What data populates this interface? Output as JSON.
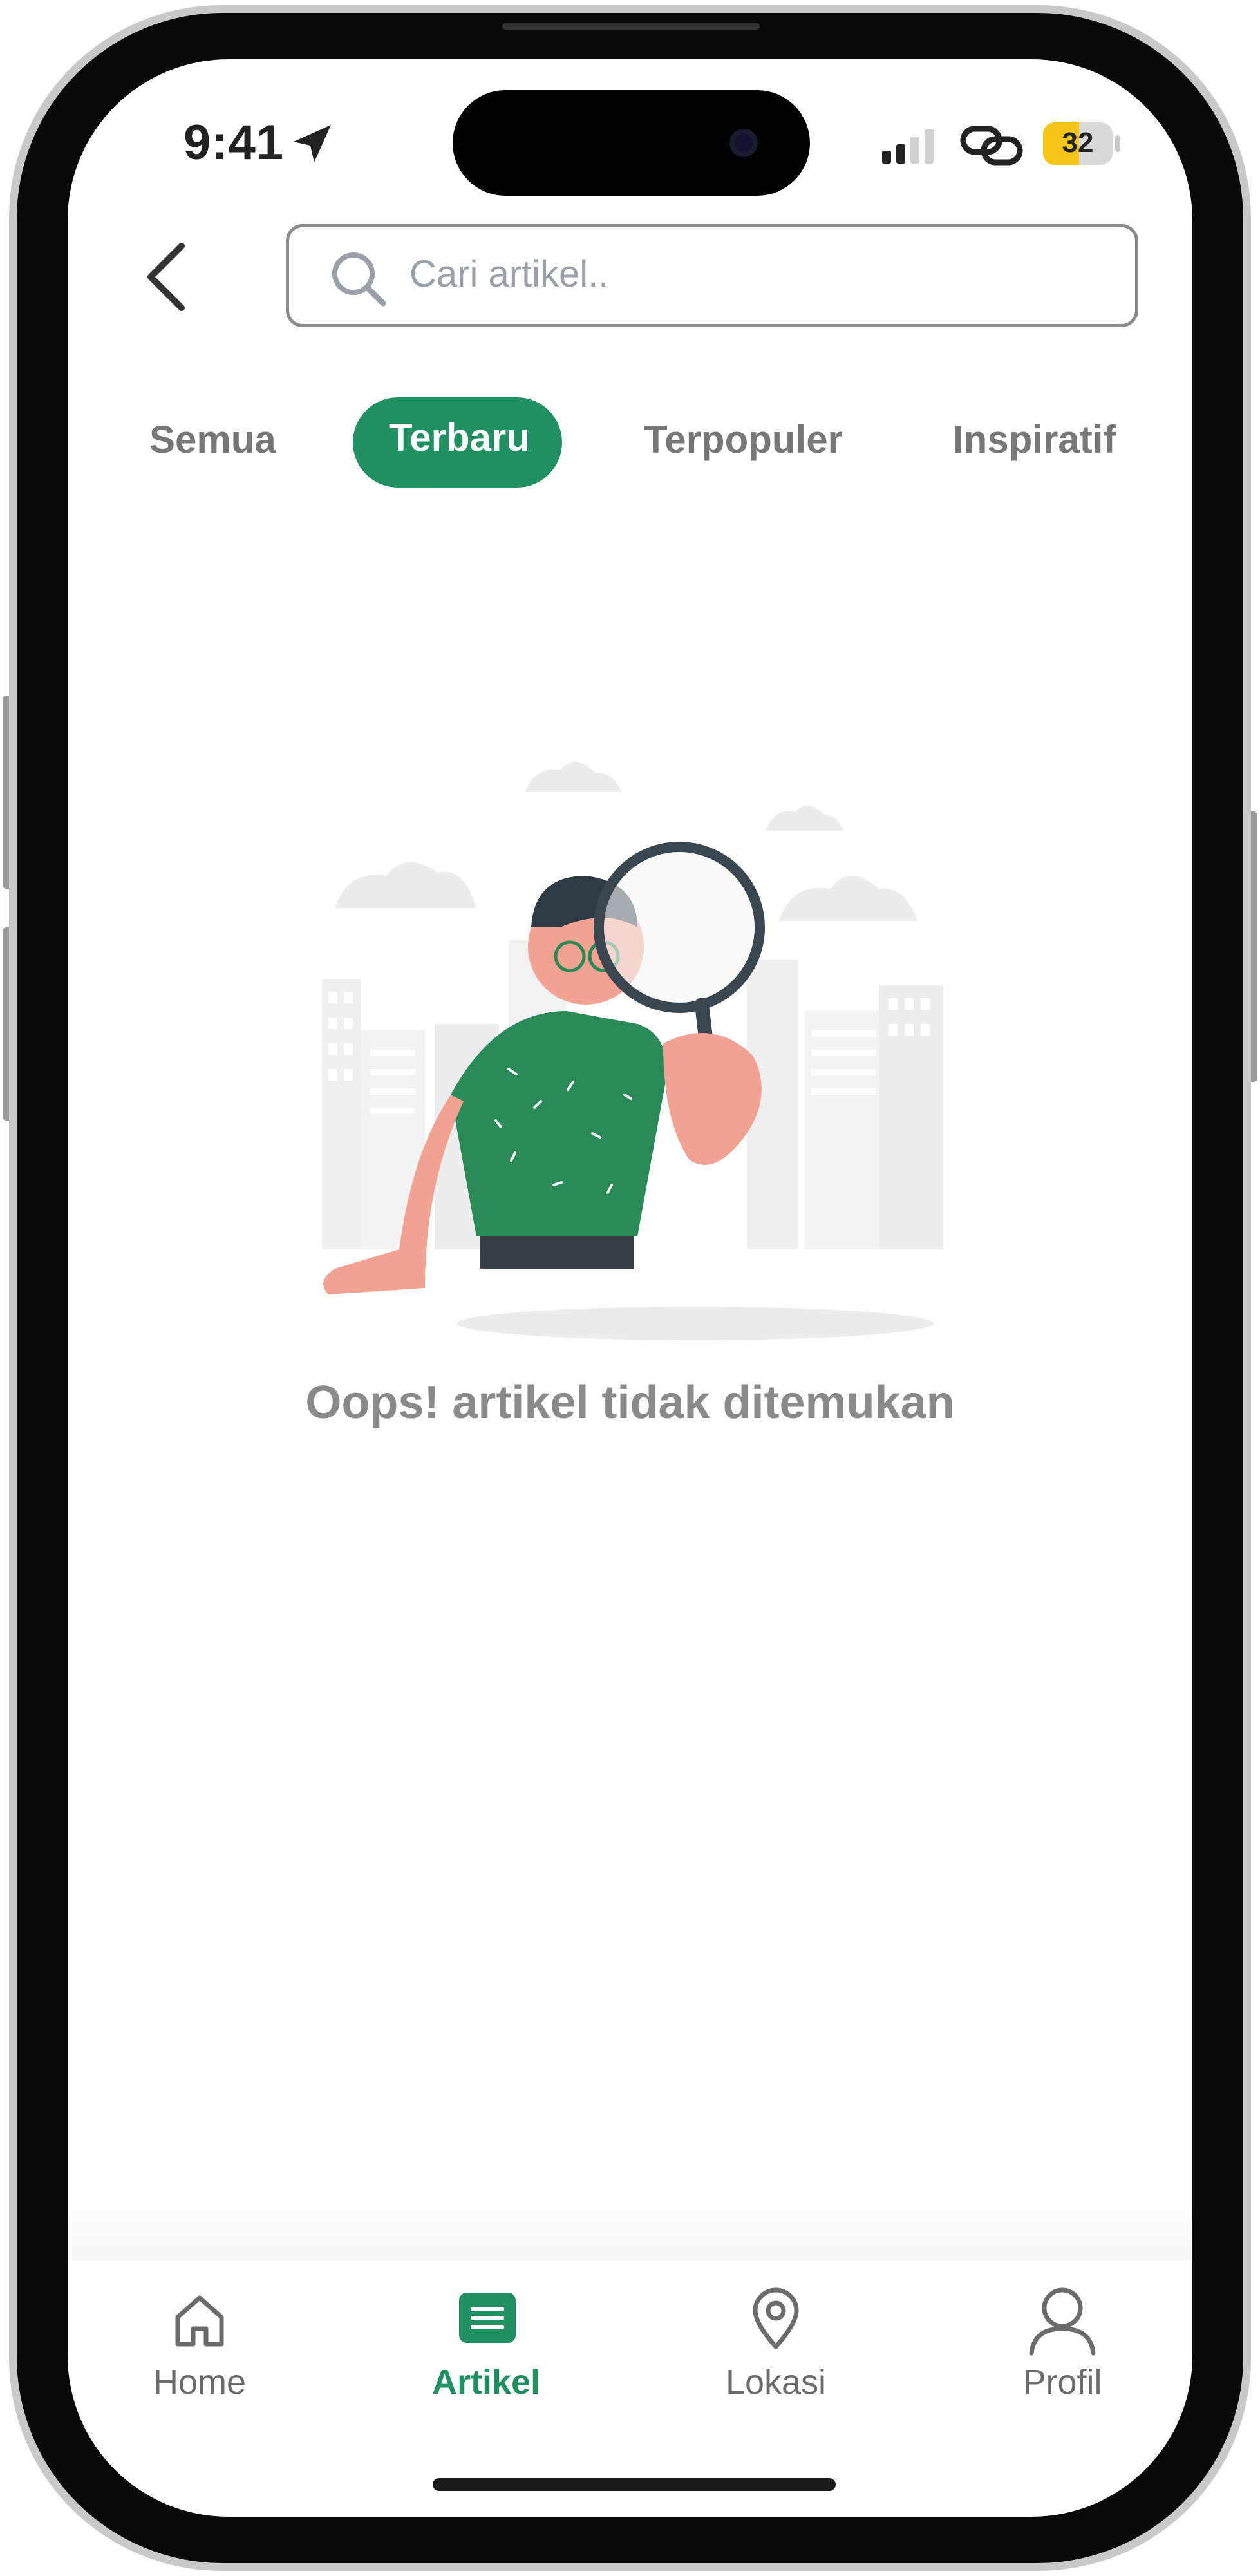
{
  "status_bar": {
    "time": "9:41",
    "battery": "32"
  },
  "header": {
    "search_placeholder": "Cari artikel.."
  },
  "tabs": [
    {
      "label": "Semua",
      "active": false
    },
    {
      "label": "Terbaru",
      "active": true
    },
    {
      "label": "Terpopuler",
      "active": false
    },
    {
      "label": "Inspiratif",
      "active": false
    }
  ],
  "empty_state": {
    "message": "Oops! artikel tidak ditemukan"
  },
  "bottom_nav": [
    {
      "label": "Home",
      "icon": "home-icon",
      "active": false
    },
    {
      "label": "Artikel",
      "icon": "article-icon",
      "active": true
    },
    {
      "label": "Lokasi",
      "icon": "location-pin-icon",
      "active": false
    },
    {
      "label": "Profil",
      "icon": "profile-icon",
      "active": false
    }
  ],
  "colors": {
    "accent": "#219060",
    "muted_text": "#8a8a8a",
    "illustration_shirt": "#2a8a57",
    "illustration_skin": "#f2a293",
    "battery_fill": "#f5c518"
  }
}
